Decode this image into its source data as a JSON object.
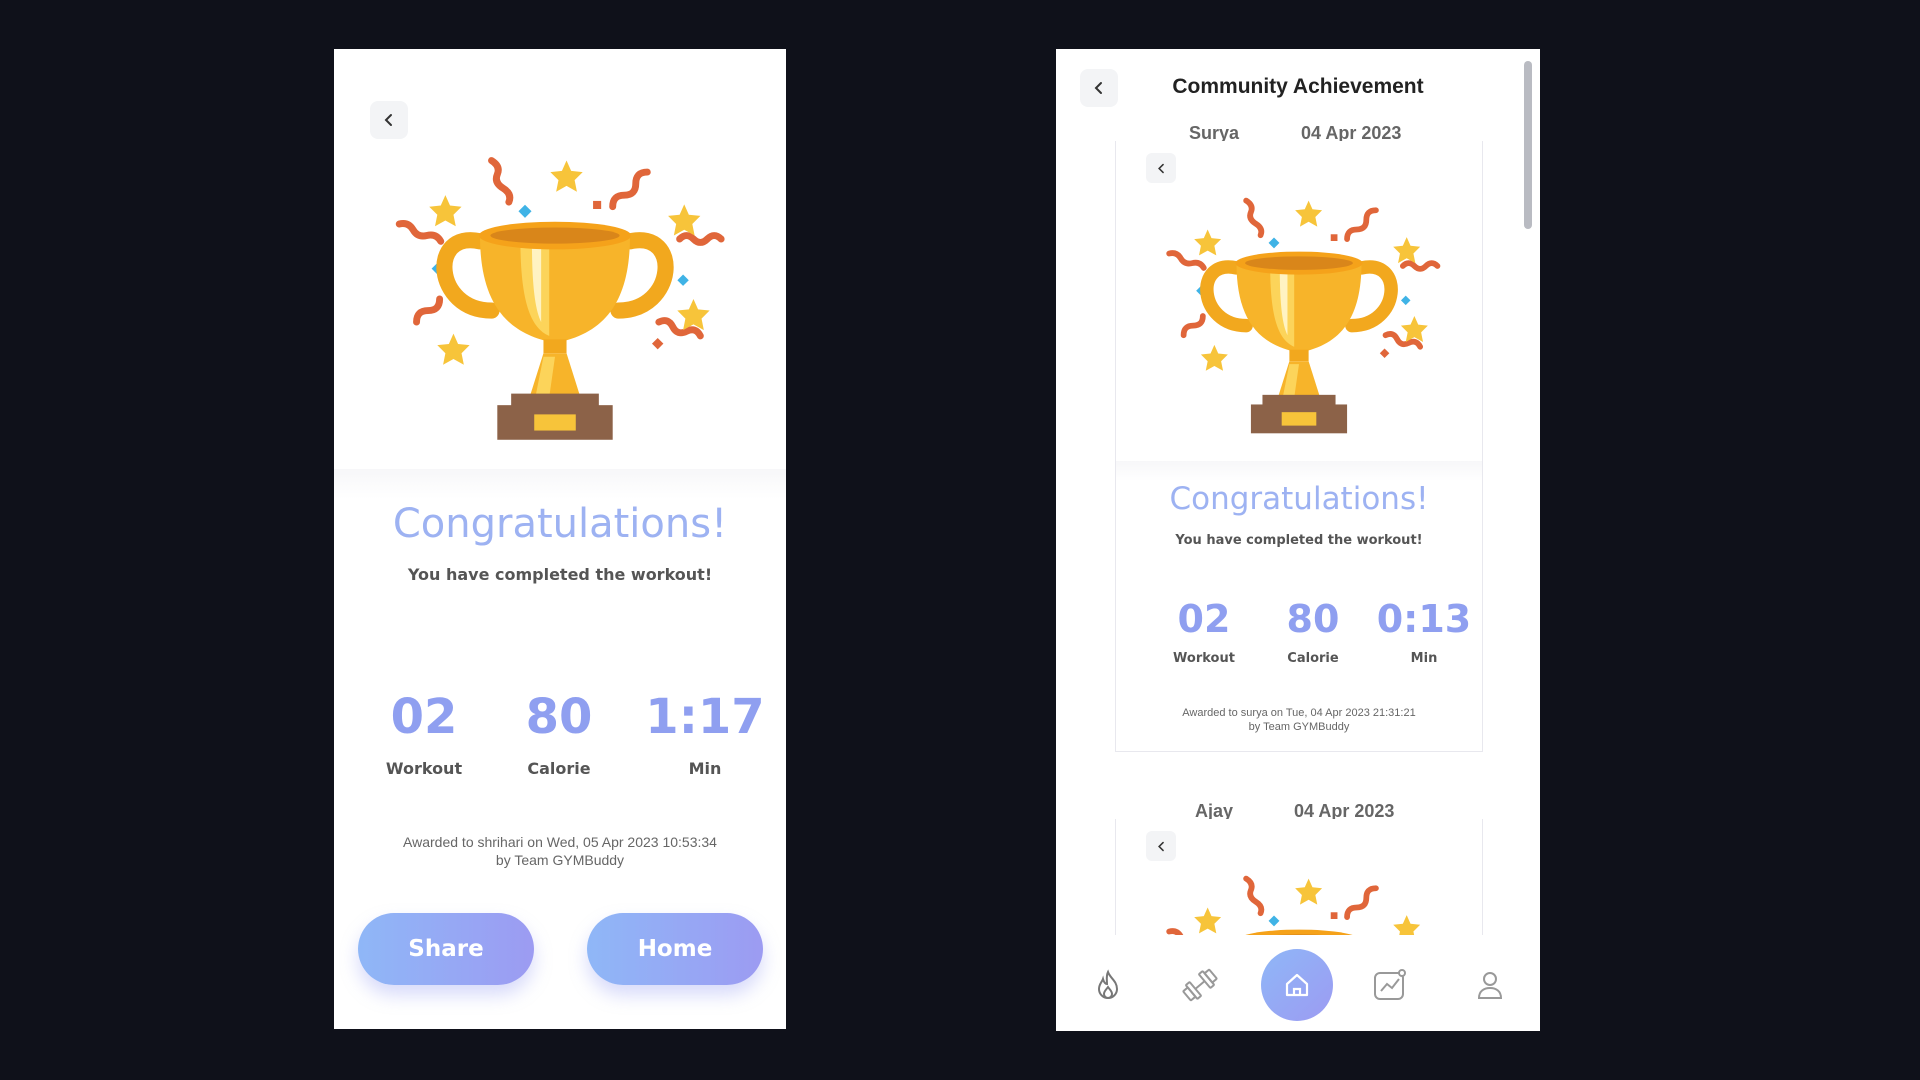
{
  "left": {
    "congrats": "Congratulations!",
    "subtitle": "You have completed the workout!",
    "stats": [
      {
        "value": "02",
        "label": "Workout"
      },
      {
        "value": "80",
        "label": "Calorie"
      },
      {
        "value": "1:17",
        "label": "Min"
      }
    ],
    "awarded_line1": "Awarded to shrihari on Wed, 05 Apr 2023 10:53:34",
    "awarded_line2": "by Team GYMBuddy",
    "share_label": "Share",
    "home_label": "Home"
  },
  "right": {
    "title": "Community Achievement",
    "feed": [
      {
        "name": "Surya",
        "date": "04 Apr 2023",
        "congrats": "Congratulations!",
        "subtitle": "You have completed the workout!",
        "stats": [
          {
            "value": "02",
            "label": "Workout"
          },
          {
            "value": "80",
            "label": "Calorie"
          },
          {
            "value": "0:13",
            "label": "Min"
          }
        ],
        "awarded_line1": "Awarded to surya on Tue, 04 Apr 2023 21:31:21",
        "awarded_line2": "by Team GYMBuddy"
      },
      {
        "name": "Ajay",
        "date": "04 Apr 2023"
      }
    ],
    "nav": [
      "flame-icon",
      "dumbbell-icon",
      "home-icon",
      "chart-icon",
      "profile-icon"
    ]
  },
  "colors": {
    "background": "#0f111a",
    "accent": "#8f9ff0",
    "congrats": "#9db2f2"
  }
}
